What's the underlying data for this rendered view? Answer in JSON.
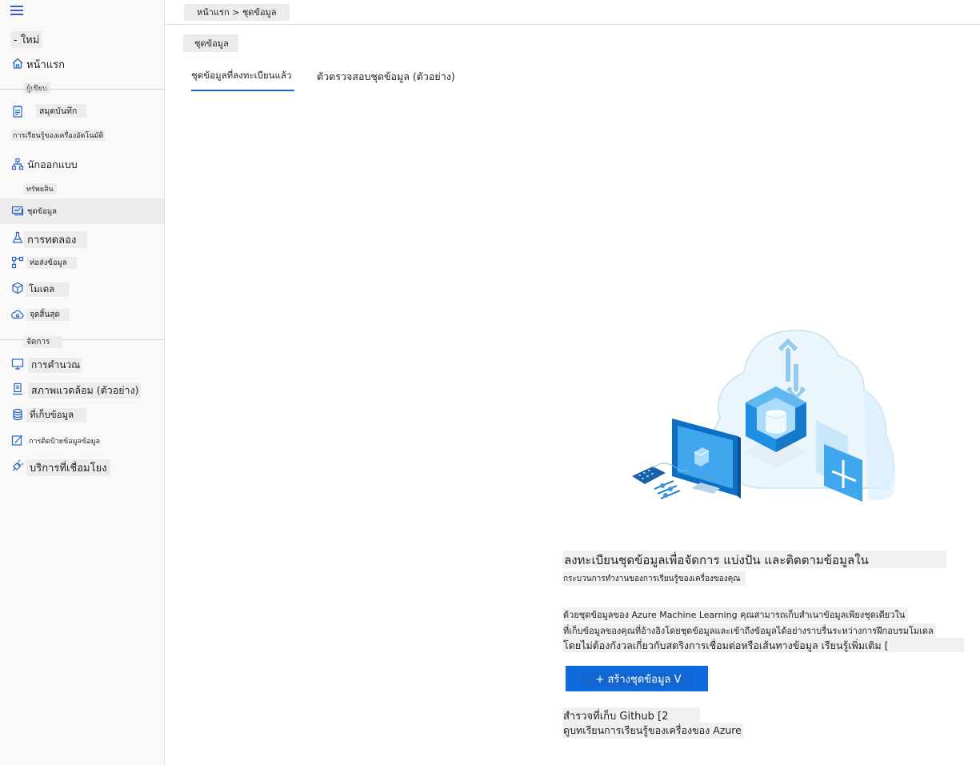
{
  "sidebar": {
    "new_label": "- ใหม่",
    "home_label": "หน้าแรก",
    "section_author": "ผู้เขียน",
    "notebooks_label": "สมุดบันทึก",
    "automl_label": "การเรียนรู้ของเครื่องอัตโนมัติ",
    "designer_label": "นักออกแบบ",
    "section_assets": "ทรัพยสิน",
    "datasets_label": "ชุดข้อมูล",
    "experiments_label": "การทดลอง",
    "pipelines_label": "ท่อส่งข้อมูล",
    "models_label": "โมเดล",
    "endpoints_label": "จุดสิ้นสุด",
    "section_manage": "จัดการ",
    "compute_label": "การคำนวณ",
    "environments_label": "สภาพแวดล้อม (ตัวอย่าง)",
    "datastores_label": "ที่เก็บข้อมูล",
    "labeling_label": "การติดป้ายข้อมูลข้อมูล",
    "linked_services_label": "บริการที่เชื่อมโยง"
  },
  "header": {
    "breadcrumb": "หน้าแรก > ชุดข้อมูล",
    "page_title": "ชุดข้อมูล"
  },
  "tabs": [
    {
      "label": "ชุดข้อมูลที่ลงทะเบียนแล้ว"
    },
    {
      "label": "ตัวตรวจสอบชุดข้อมูล (ตัวอย่าง)"
    }
  ],
  "empty_state": {
    "headline": "ลงทะเบียนชุดข้อมูลเพื่อจัดการ แบ่งปัน และติดตามข้อมูลใน",
    "subheadline": "กระบวนการทำงานของการเรียนรู้ของเครื่องของคุณ",
    "desc_line1": "ด้วยชุดข้อมูลของ Azure Machine Learning คุณสามารถเก็บสำเนาข้อมูลเพียงชุดเดียวใน",
    "desc_line2": "ที่เก็บข้อมูลของคุณที่อ้างอิงโดยชุดข้อมูลและเข้าถึงข้อมูลได้อย่างราบรื่นระหว่างการฝึกอบรมโมเดล",
    "desc_line3": "โดยไม่ต้องกังวลเกี่ยวกับสตริงการเชื่อมต่อหรือเส้นทางข้อมูล เรียนรู้เพิ่มเติม [",
    "create_button": "+ สร้างชุดข้อมูล V",
    "link_github": "สำรวจที่เก็บ Github [2",
    "link_tutorial": "ดูบทเรียนการเรียนรู้ของเครื่องของ Azure"
  },
  "colors": {
    "accent": "#2464c4",
    "button": "#0f6cde",
    "sidebar_bg": "#faf9f8",
    "active_item_bg": "#edebe9"
  }
}
